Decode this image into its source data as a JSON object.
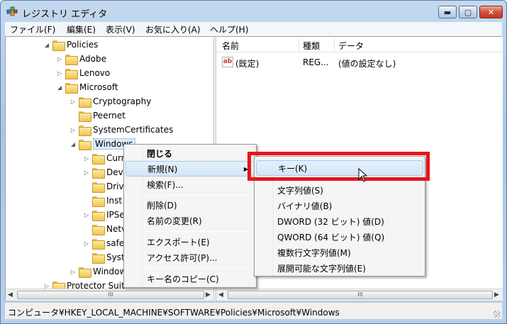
{
  "window": {
    "title": "レジストリ エディタ",
    "controls": {
      "minimize": "▬",
      "maximize": "▢",
      "close": "✕"
    }
  },
  "menubar": [
    "ファイル(F)",
    "編集(E)",
    "表示(V)",
    "お気に入り(A)",
    "ヘルプ(H)"
  ],
  "tree": {
    "items": [
      {
        "label": "Policies",
        "expander": "◢"
      },
      {
        "label": "Adobe",
        "expander": "▷"
      },
      {
        "label": "Lenovo",
        "expander": "▷"
      },
      {
        "label": "Microsoft",
        "expander": "◢"
      },
      {
        "label": "Cryptography",
        "expander": "▷"
      },
      {
        "label": "Peernet",
        "expander": ""
      },
      {
        "label": "SystemCertificates",
        "expander": "▷"
      },
      {
        "label": "Windows",
        "expander": "◢"
      },
      {
        "label": "Curr",
        "expander": "▷"
      },
      {
        "label": "Dev",
        "expander": "▷"
      },
      {
        "label": "Driv",
        "expander": ""
      },
      {
        "label": "Inst",
        "expander": ""
      },
      {
        "label": "IPSe",
        "expander": "▷"
      },
      {
        "label": "Netv",
        "expander": ""
      },
      {
        "label": "safe",
        "expander": "▷"
      },
      {
        "label": "Syst",
        "expander": ""
      },
      {
        "label": "Window",
        "expander": "▷"
      },
      {
        "label": "Protector Suit",
        "expander": "▷"
      }
    ]
  },
  "list": {
    "columns": [
      "名前",
      "種類",
      "データ"
    ],
    "rows": [
      {
        "icon": "ab",
        "name": "(既定)",
        "type": "REG...",
        "data": "(値の設定なし)"
      }
    ]
  },
  "context_menu": {
    "items": [
      "閉じる",
      "新規(N)",
      "検索(F)...",
      "削除(D)",
      "名前の変更(R)",
      "エクスポート(E)",
      "アクセス許可(P)...",
      "キー名のコピー(C)"
    ]
  },
  "submenu": {
    "items": [
      "キー(K)",
      "文字列値(S)",
      "バイナリ値(B)",
      "DWORD (32 ビット) 値(D)",
      "QWORD (64 ビット) 値(Q)",
      "複数行文字列値(M)",
      "展開可能な文字列値(E)"
    ]
  },
  "scroll": {
    "thumb": "III",
    "left": "◀",
    "right": "▶"
  },
  "status": "コンピュータ¥HKEY_LOCAL_MACHINE¥SOFTWARE¥Policies¥Microsoft¥Windows",
  "colors": {
    "highlight": "#e8141b",
    "title_bg": "#b8d0ea",
    "hover": "#d5e6f8"
  }
}
